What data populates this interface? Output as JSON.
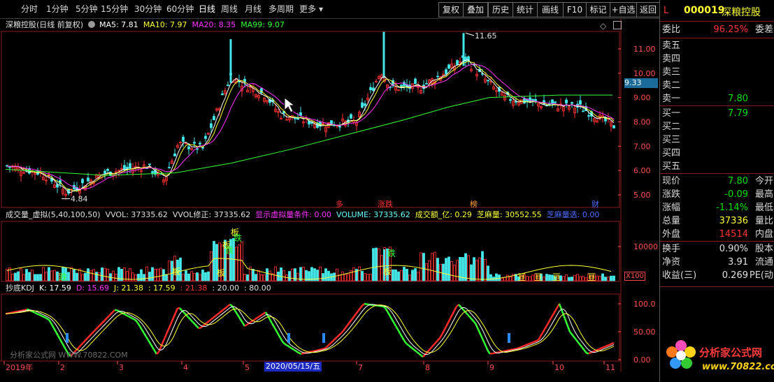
{
  "toolbar": {
    "periods": [
      "分时",
      "1分钟",
      "5分钟",
      "15分钟",
      "30分钟",
      "60分钟",
      "日线",
      "周线",
      "月线",
      "多周期",
      "更多"
    ],
    "active": "日线",
    "right_buttons": [
      "复权",
      "叠加",
      "历史",
      "统计",
      "画线",
      "F10",
      "标记",
      "+自选",
      "返回"
    ]
  },
  "main_legend": {
    "title": "深粮控股(日线 前复权)",
    "ma5": "MA5: 7.81",
    "ma10": "MA10: 7.97",
    "ma20": "MA20: 8.35",
    "ma99": "MA99: 9.07"
  },
  "price_axis": {
    "labels": [
      "11.00",
      "10.00",
      "9.00",
      "8.00",
      "7.00",
      "6.00",
      "5.00"
    ],
    "current_tag": "9.33",
    "high_mark": "11.65",
    "low_mark": "4.84"
  },
  "event_marks": [
    "多",
    "涨跌",
    "榜",
    "财"
  ],
  "volume_legend": {
    "a": "成交量_虚拟(5,40,100,50)",
    "b": "VVOL: 37335.62",
    "c": "VVOL修正: 37335.62",
    "d": "显示虚拟量条件: 0.00",
    "e": "VOLUME: 37335.62",
    "f": "成交额_亿: 0.29",
    "g": "芝麻量: 30552.55",
    "h": "芝麻量选: 0.00"
  },
  "volume_axis": {
    "label": "10000",
    "unit": "X100"
  },
  "volume_marks": [
    "板",
    "跌",
    "板",
    "跌",
    "跌",
    "板",
    "板",
    "板",
    "跌",
    "亘",
    "亘",
    "亘",
    "亘"
  ],
  "kdj_legend": {
    "title": "抄底KDJ",
    "k": "K: 17.59",
    "d": "D: 15.69",
    "j": "J: 21.38",
    "v1": ": 17.59",
    "v2": ": 21.38",
    "v3": ": 20.00",
    "v4": ": 80.00"
  },
  "kdj_axis": {
    "labels": [
      "100.0",
      "50.00",
      "0.00"
    ]
  },
  "x_axis": {
    "labels": [
      "2019年",
      "2",
      "3",
      "4",
      "5",
      "7",
      "8",
      "9",
      "10",
      "11"
    ],
    "cursor_date": "2020/05/15/五"
  },
  "watermark": "分析家公式网 WWW.70822.COM",
  "quote": {
    "flag": "L",
    "code": "000019",
    "name": "深粮控股",
    "weibi_label": "委比",
    "weibi_value": "96.25%",
    "weicha_label": "委差",
    "sell": [
      "卖五",
      "卖四",
      "卖三",
      "卖二",
      "卖一"
    ],
    "sell1_price": "7.80",
    "buy": [
      "买一",
      "买二",
      "买三",
      "买四",
      "买五"
    ],
    "buy1_price": "7.79",
    "rows": [
      {
        "l": "现价",
        "v": "7.80",
        "r": "今开",
        "c": "#00e000"
      },
      {
        "l": "涨跌",
        "v": "-0.09",
        "r": "最高",
        "c": "#00e000"
      },
      {
        "l": "涨幅",
        "v": "-1.14%",
        "r": "最低",
        "c": "#00e000"
      },
      {
        "l": "总量",
        "v": "37336",
        "r": "量比",
        "c": "#ffff33"
      },
      {
        "l": "外盘",
        "v": "14514",
        "r": "内盘",
        "c": "#ff3333"
      }
    ],
    "rows2": [
      {
        "l": "换手",
        "v": "0.90%",
        "r": "股本",
        "c": "#e0e0e0"
      },
      {
        "l": "净资",
        "v": "3.91",
        "r": "流通",
        "c": "#e0e0e0"
      },
      {
        "l": "收益(三)",
        "v": "0.269",
        "r": "PE(动",
        "c": "#e0e0e0"
      }
    ]
  },
  "logo": {
    "title": "分析家公式网",
    "url": "www.70822.com"
  }
}
